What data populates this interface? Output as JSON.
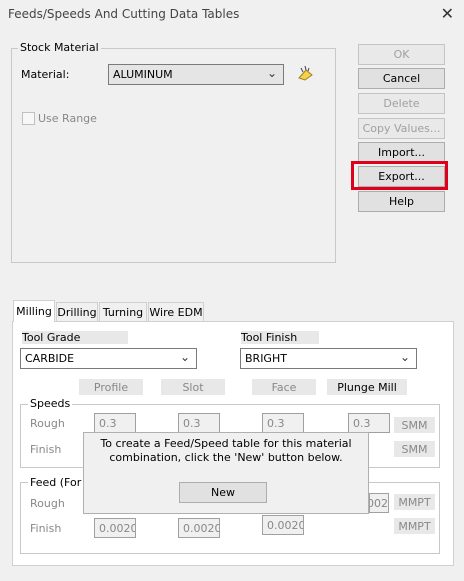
{
  "window": {
    "title": "Feeds/Speeds And Cutting Data Tables"
  },
  "stock": {
    "group_label": "Stock Material",
    "material_label": "Material:",
    "material_value": "ALUMINUM",
    "use_range_label": "Use Range"
  },
  "buttons": {
    "ok": "OK",
    "cancel": "Cancel",
    "delete": "Delete",
    "copy_values": "Copy Values...",
    "import": "Import...",
    "export": "Export...",
    "help": "Help"
  },
  "tabs": [
    "Milling",
    "Drilling",
    "Turning",
    "Wire EDM"
  ],
  "milling": {
    "tool_grade_label": "Tool Grade",
    "tool_grade_value": "CARBIDE",
    "tool_finish_label": "Tool Finish",
    "tool_finish_value": "BRIGHT",
    "columns": [
      "Profile",
      "Slot",
      "Face",
      "Plunge Mill"
    ],
    "speeds": {
      "label": "Speeds",
      "rough_label": "Rough",
      "finish_label": "Finish",
      "rough_values": [
        "0.3",
        "0.3",
        "0.3",
        "0.3"
      ],
      "unit_rough": "SMM",
      "unit_finish": "SMM"
    },
    "feed": {
      "label": "Feed (For",
      "rough_label": "Rough",
      "finish_label": "Finish",
      "rough_partial_value": "0.002",
      "finish_values": [
        "0.0020",
        "0.0020",
        "0.0020"
      ],
      "unit_rough": "MMPT",
      "unit_finish": "MMPT"
    }
  },
  "dialog": {
    "message": "To create a Feed/Speed table for this material combination, click the 'New' button below.",
    "new_button": "New"
  }
}
